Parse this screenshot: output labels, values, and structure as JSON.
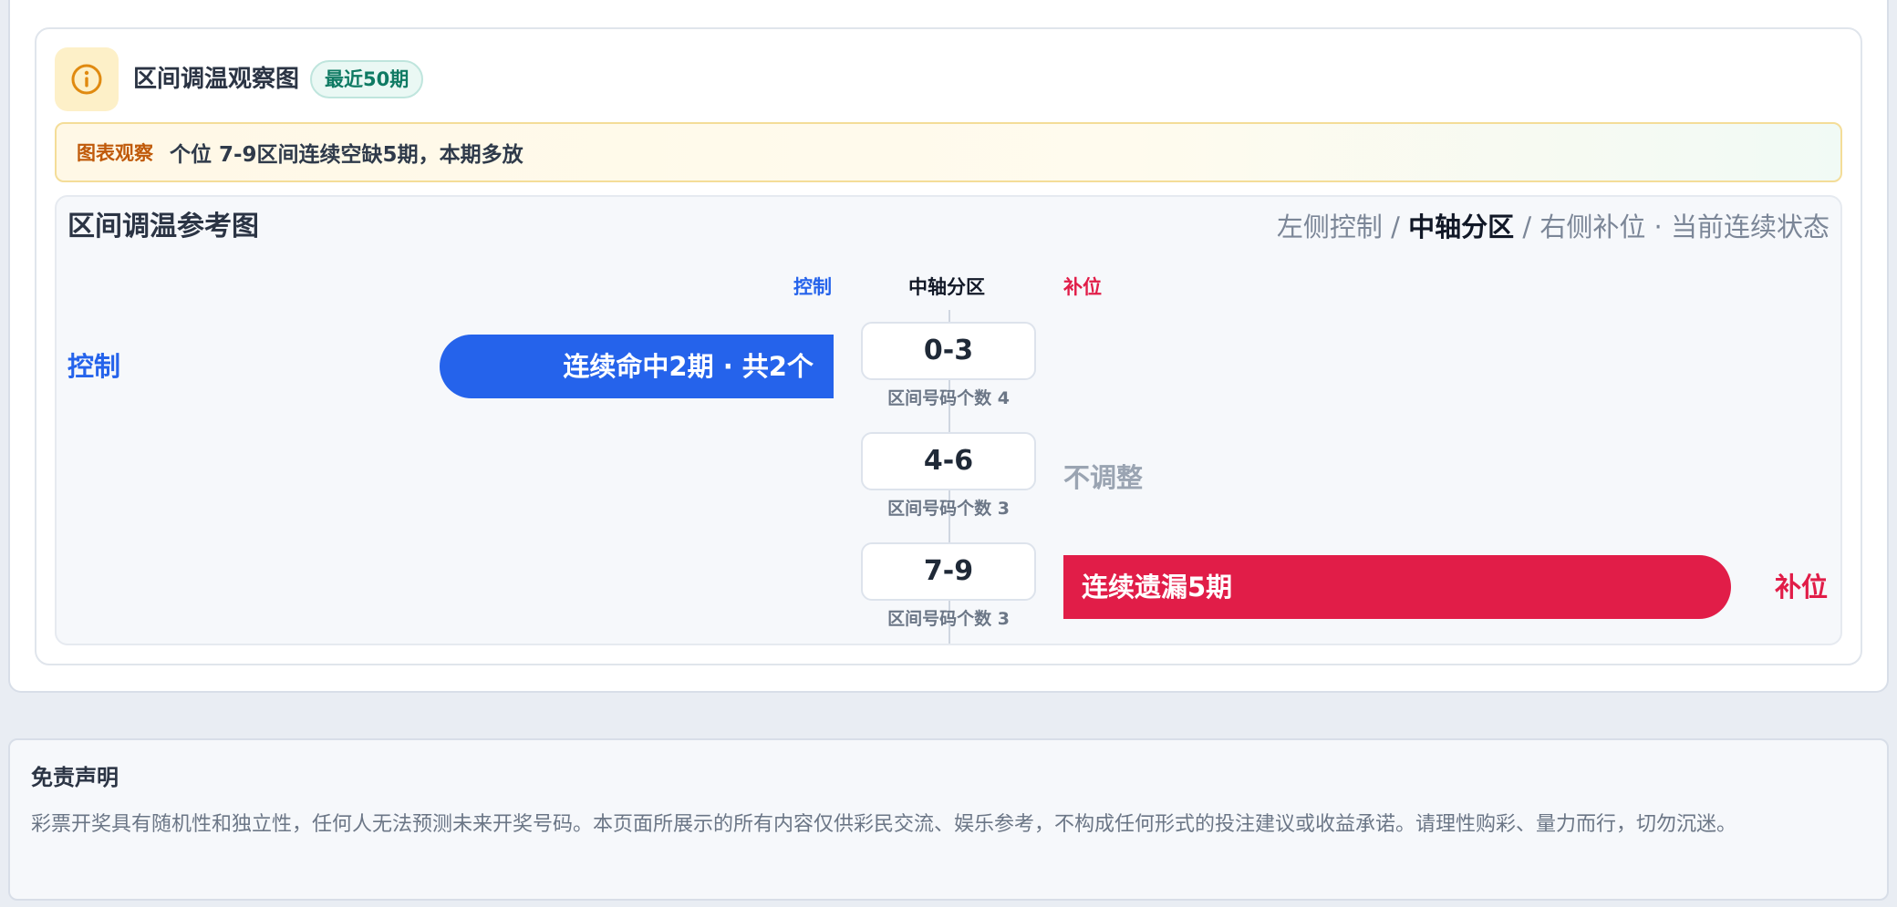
{
  "header": {
    "title": "区间调温观察图",
    "badge": "最近50期",
    "icon": "info-icon",
    "icon_color": "#e08a10"
  },
  "observation": {
    "label": "图表观察",
    "text": "个位 7-9区间连续空缺5期，本期多放"
  },
  "chart": {
    "title": "区间调温参考图",
    "desc_left": "左侧控制 /",
    "desc_bold": "中轴分区",
    "desc_right": "/ 右侧补位 · 当前连续状态",
    "col_control": "控制",
    "col_axis": "中轴分区",
    "col_fill": "补位",
    "colors": {
      "control": "#2563eb",
      "fill": "#e11d48",
      "neutral": "#9aa4b2"
    }
  },
  "chart_data": {
    "type": "table",
    "zones": [
      {
        "range": "0-3",
        "sub": "区间号码个数 4",
        "side": "control",
        "row_label": "控制",
        "bar_text": "连续命中2期 · 共2个"
      },
      {
        "range": "4-6",
        "sub": "区间号码个数 3",
        "side": "none",
        "status": "不调整"
      },
      {
        "range": "7-9",
        "sub": "区间号码个数 3",
        "side": "fill",
        "row_label": "补位",
        "bar_text": "连续遗漏5期"
      }
    ]
  },
  "disclaimer": {
    "title": "免责声明",
    "text": "彩票开奖具有随机性和独立性，任何人无法预测未来开奖号码。本页面所展示的所有内容仅供彩民交流、娱乐参考，不构成任何形式的投注建议或收益承诺。请理性购彩、量力而行，切勿沉迷。"
  }
}
